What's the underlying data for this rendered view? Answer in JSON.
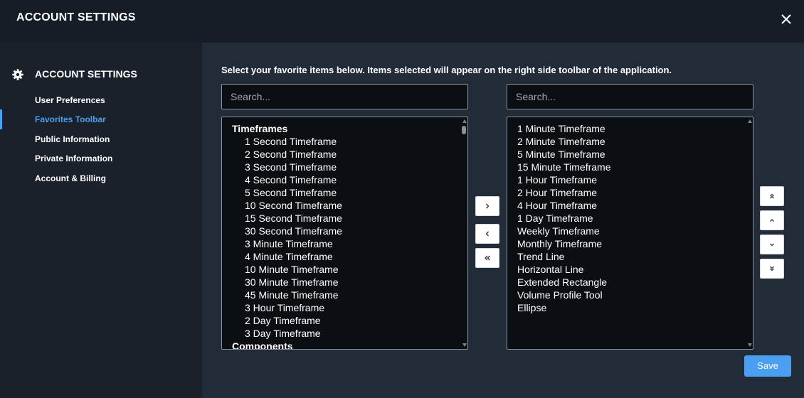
{
  "header": {
    "title": "ACCOUNT SETTINGS",
    "close_icon": "close-icon"
  },
  "sidebar": {
    "heading": "ACCOUNT SETTINGS",
    "heading_icon": "gear-icon",
    "items": [
      {
        "label": "User Preferences",
        "active": false
      },
      {
        "label": "Favorites Toolbar",
        "active": true
      },
      {
        "label": "Public Information",
        "active": false
      },
      {
        "label": "Private Information",
        "active": false
      },
      {
        "label": "Account & Billing",
        "active": false
      }
    ]
  },
  "main": {
    "instructions": "Select your favorite items below. Items selected will appear on the right side toolbar of the application.",
    "left_search": {
      "placeholder": "Search...",
      "value": ""
    },
    "right_search": {
      "placeholder": "Search...",
      "value": ""
    },
    "available": [
      {
        "label": "Timeframes",
        "group": true
      },
      {
        "label": "1 Second Timeframe"
      },
      {
        "label": "2 Second Timeframe"
      },
      {
        "label": "3 Second Timeframe"
      },
      {
        "label": "4 Second Timeframe"
      },
      {
        "label": "5 Second Timeframe"
      },
      {
        "label": "10 Second Timeframe"
      },
      {
        "label": "15 Second Timeframe"
      },
      {
        "label": "30 Second Timeframe"
      },
      {
        "label": "3 Minute Timeframe"
      },
      {
        "label": "4 Minute Timeframe"
      },
      {
        "label": "10 Minute Timeframe"
      },
      {
        "label": "30 Minute Timeframe"
      },
      {
        "label": "45 Minute Timeframe"
      },
      {
        "label": "3 Hour Timeframe"
      },
      {
        "label": "2 Day Timeframe"
      },
      {
        "label": "3 Day Timeframe"
      },
      {
        "label": "Components",
        "group": true
      }
    ],
    "selected": [
      "1 Minute Timeframe",
      "2 Minute Timeframe",
      "5 Minute Timeframe",
      "15 Minute Timeframe",
      "1 Hour Timeframe",
      "2 Hour Timeframe",
      "4 Hour Timeframe",
      "1 Day Timeframe",
      "Weekly Timeframe",
      "Monthly Timeframe",
      "Trend Line",
      "Horizontal Line",
      "Extended Rectangle",
      "Volume Profile Tool",
      "Ellipse"
    ],
    "transfer_buttons": [
      {
        "name": "add-button",
        "icon": "chevron-right-icon"
      },
      {
        "name": "remove-button",
        "icon": "chevron-left-icon"
      },
      {
        "name": "remove-all-button",
        "icon": "double-chevron-left-icon"
      }
    ],
    "order_buttons": [
      {
        "name": "move-top-button",
        "icon": "double-chevron-up-icon"
      },
      {
        "name": "move-up-button",
        "icon": "chevron-up-icon"
      },
      {
        "name": "move-down-button",
        "icon": "chevron-down-icon"
      },
      {
        "name": "move-bottom-button",
        "icon": "double-chevron-down-icon"
      }
    ],
    "save_label": "Save"
  },
  "colors": {
    "accent": "#4a9ff0",
    "panel": "#222b38",
    "list_bg": "#0b0e13"
  }
}
